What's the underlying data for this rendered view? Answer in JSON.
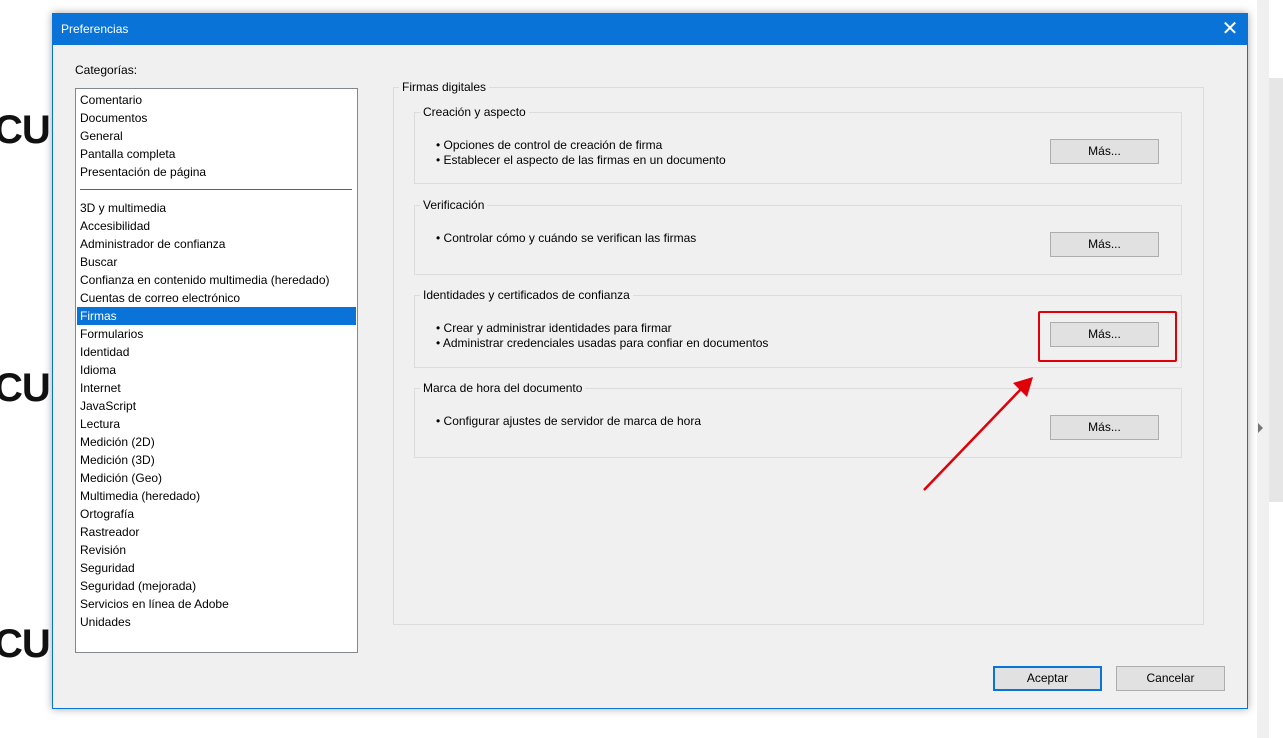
{
  "background": {
    "fragments": [
      "CUI",
      "CUI",
      "CUI"
    ]
  },
  "dialog": {
    "title": "Preferencias",
    "close_glyph": "✕",
    "categories_label": "Categorías:",
    "categories_top": [
      "Comentario",
      "Documentos",
      "General",
      "Pantalla completa",
      "Presentación de página"
    ],
    "categories": [
      "3D y multimedia",
      "Accesibilidad",
      "Administrador de confianza",
      "Buscar",
      "Confianza en contenido multimedia (heredado)",
      "Cuentas de correo electrónico",
      "Firmas",
      "Formularios",
      "Identidad",
      "Idioma",
      "Internet",
      "JavaScript",
      "Lectura",
      "Medición (2D)",
      "Medición (3D)",
      "Medición (Geo)",
      "Multimedia (heredado)",
      "Ortografía",
      "Rastreador",
      "Revisión",
      "Seguridad",
      "Seguridad (mejorada)",
      "Servicios en línea de Adobe",
      "Unidades"
    ],
    "selected_category": "Firmas",
    "main_group_label": "Firmas digitales",
    "sections": [
      {
        "label": "Creación y aspecto",
        "bullets": [
          "• Opciones de control de creación de firma",
          "• Establecer el aspecto de las firmas en un documento"
        ],
        "button": "Más..."
      },
      {
        "label": "Verificación",
        "bullets": [
          "• Controlar cómo y cuándo se verifican las firmas"
        ],
        "button": "Más..."
      },
      {
        "label": "Identidades y certificados de confianza",
        "bullets": [
          "• Crear y administrar identidades para firmar",
          "• Administrar credenciales usadas para confiar en documentos"
        ],
        "button": "Más..."
      },
      {
        "label": "Marca de hora del documento",
        "bullets": [
          "• Configurar ajustes de servidor de marca de hora"
        ],
        "button": "Más..."
      }
    ],
    "ok_label": "Aceptar",
    "cancel_label": "Cancelar"
  },
  "colors": {
    "accent": "#0a73d8",
    "annotation": "#e0000a"
  }
}
